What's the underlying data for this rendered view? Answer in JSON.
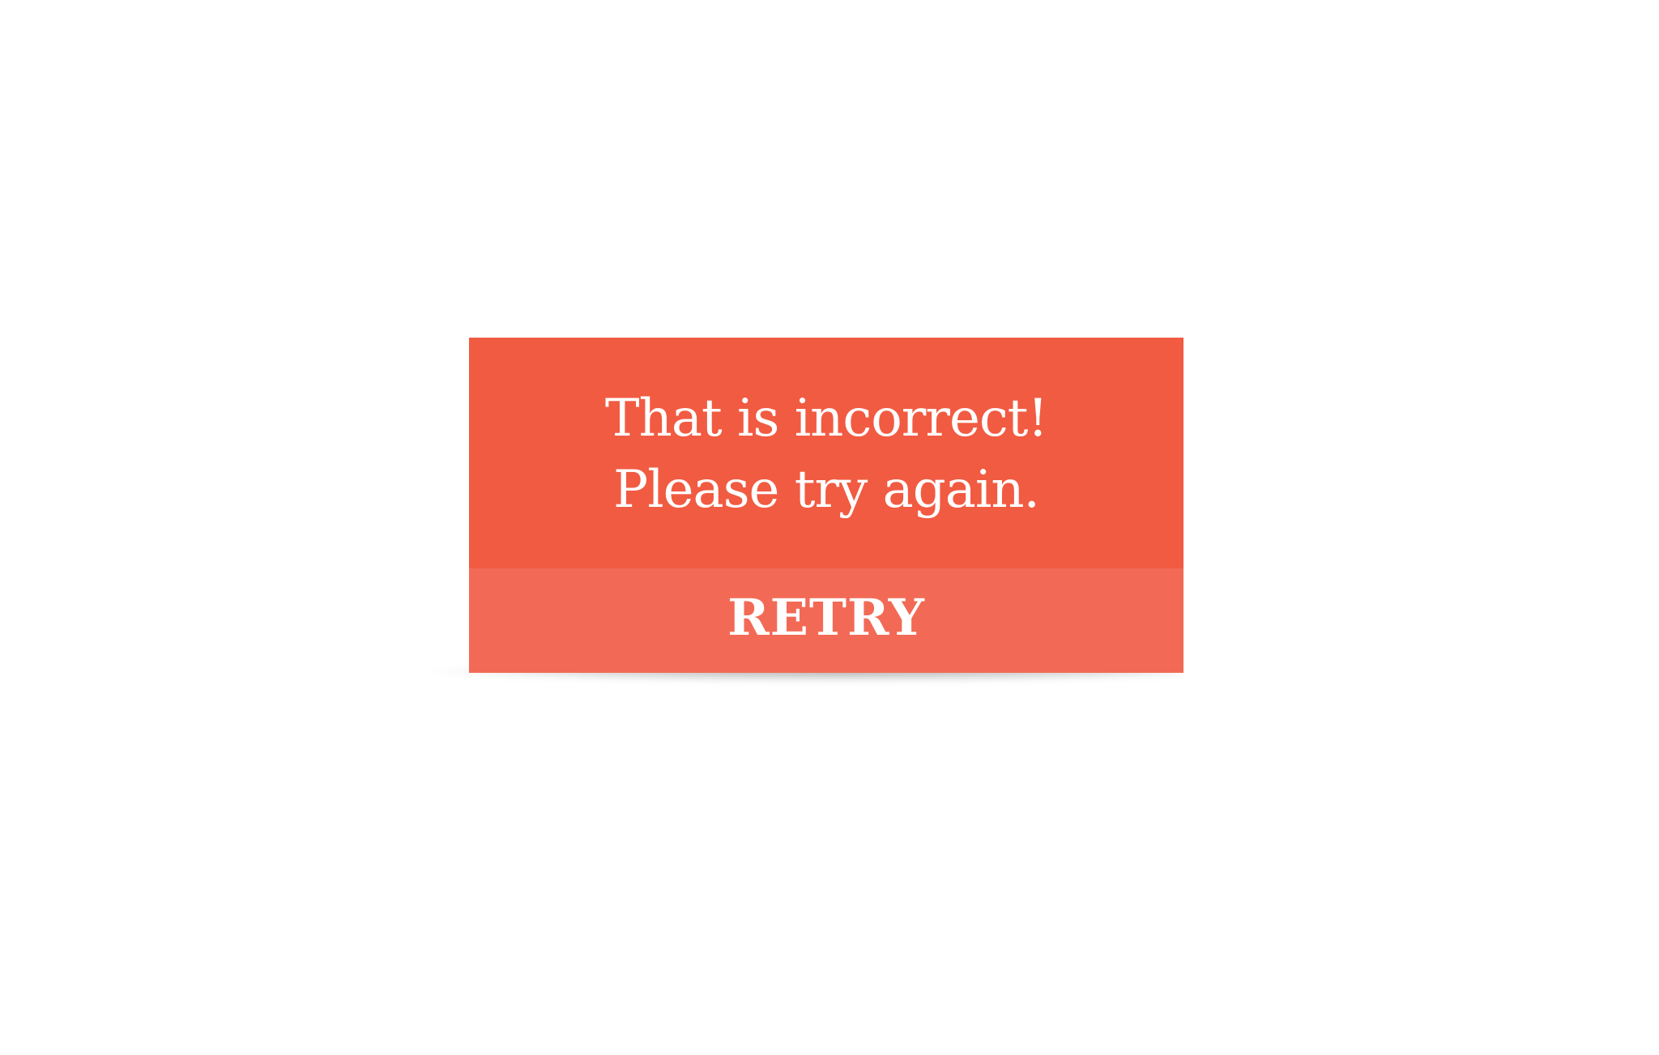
{
  "dialog": {
    "message_line_1": "That is incorrect!",
    "message_line_2": "Please try again.",
    "retry_label": "RETRY"
  },
  "colors": {
    "message_background": "#F15B42",
    "button_background": "#F26A56",
    "text": "#FFFFFF",
    "page_background": "#FFFFFF"
  }
}
